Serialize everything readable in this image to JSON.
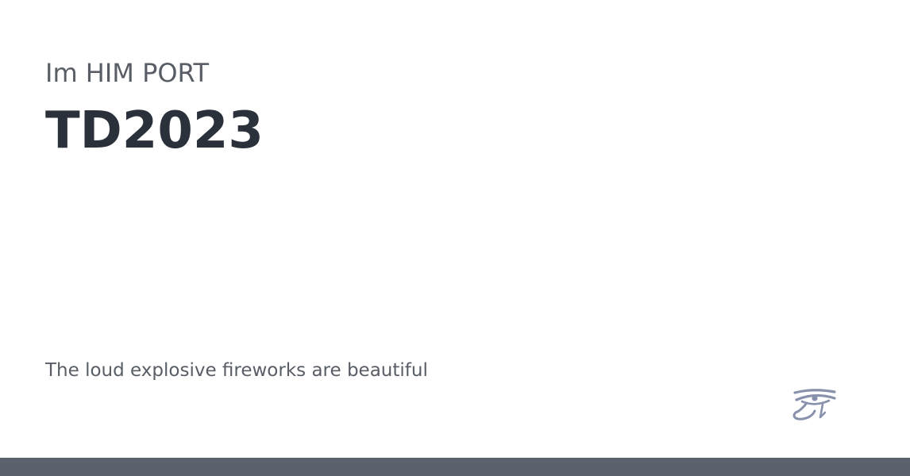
{
  "card": {
    "eyebrow": "Im HIM PORT",
    "title": "TD2023",
    "description": "The loud explosive fireworks are beautiful",
    "logo_icon": "eye-of-horus-icon"
  },
  "colors": {
    "background": "#ffffff",
    "title": "#2b313a",
    "text": "#585d66",
    "logo": "#8891ab",
    "bottom_bar": "#5b616d"
  }
}
